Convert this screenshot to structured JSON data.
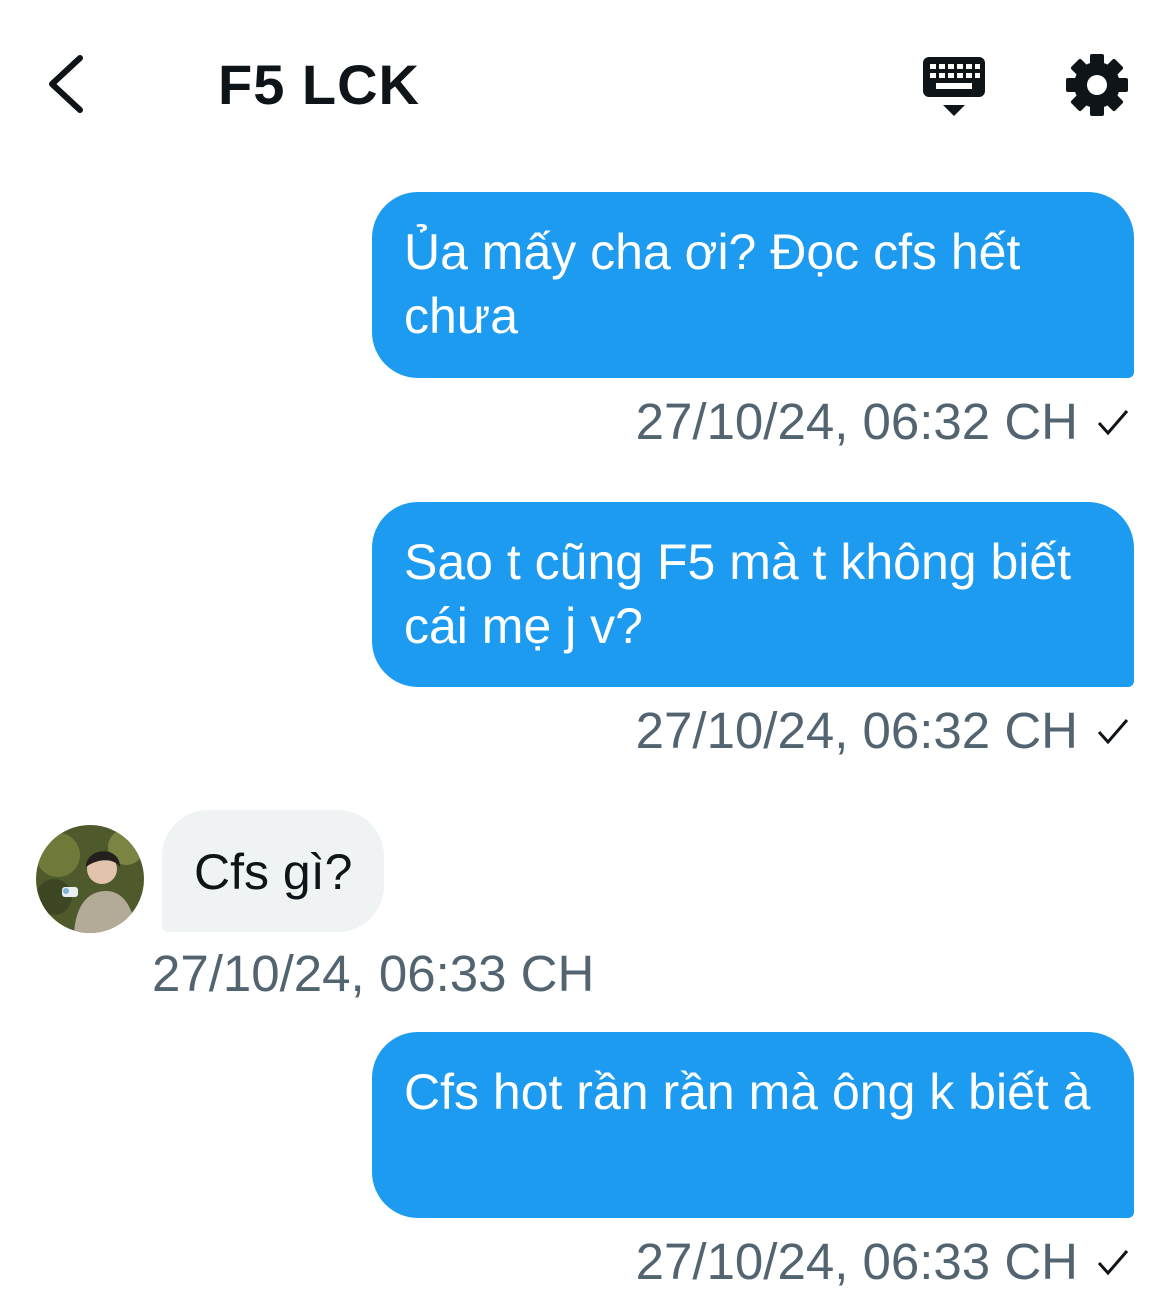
{
  "header": {
    "title": "F5 LCK",
    "back_icon": "chevron-left-icon",
    "keyboard_icon": "keyboard-icon",
    "settings_icon": "gear-icon"
  },
  "colors": {
    "outgoing_bubble": "#1d9bf0",
    "incoming_bubble": "#eff3f4",
    "timestamp": "#536471",
    "title": "#0f1419"
  },
  "messages": [
    {
      "direction": "outgoing",
      "text": "Ủa mấy cha ơi? Đọc cfs hết chưa",
      "time": "27/10/24, 06:32 CH",
      "status": "sent"
    },
    {
      "direction": "outgoing",
      "text": "Sao t cũng F5 mà t không biết cái mẹ j v?",
      "time": "27/10/24, 06:32 CH",
      "status": "sent"
    },
    {
      "direction": "incoming",
      "text": "Cfs gì?",
      "time": "27/10/24, 06:33 CH"
    },
    {
      "direction": "outgoing",
      "text": "Cfs hot rần rần mà ông k biết à",
      "time": "27/10/24, 06:33 CH",
      "status": "sent"
    }
  ]
}
